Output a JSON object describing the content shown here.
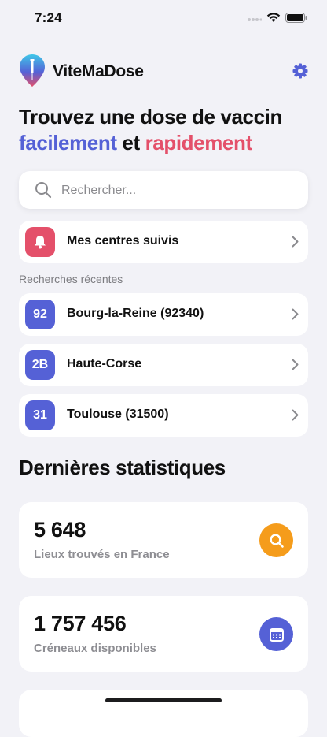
{
  "status_bar": {
    "time": "7:24"
  },
  "app": {
    "name": "ViteMaDose"
  },
  "hero": {
    "line1": "Trouvez une dose de vaccin",
    "word_blue": "facilement",
    "word_mid": " et ",
    "word_red": "rapidement"
  },
  "search": {
    "placeholder": "Rechercher...",
    "value": ""
  },
  "followed": {
    "label": "Mes centres suivis"
  },
  "recent": {
    "caption": "Recherches récentes",
    "items": [
      {
        "badge": "92",
        "label": "Bourg-la-Reine (92340)"
      },
      {
        "badge": "2B",
        "label": "Haute-Corse"
      },
      {
        "badge": "31",
        "label": "Toulouse (31500)"
      }
    ]
  },
  "stats": {
    "title": "Dernières statistiques",
    "cards": [
      {
        "value": "5 648",
        "caption": "Lieux trouvés en France",
        "icon": "search-icon"
      },
      {
        "value": "1 757 456",
        "caption": "Créneaux disponibles",
        "icon": "calendar-icon"
      }
    ]
  },
  "colors": {
    "accent_blue": "#5561d6",
    "accent_red": "#e4506a",
    "accent_orange": "#f59c1b",
    "background": "#f2f2f7"
  }
}
